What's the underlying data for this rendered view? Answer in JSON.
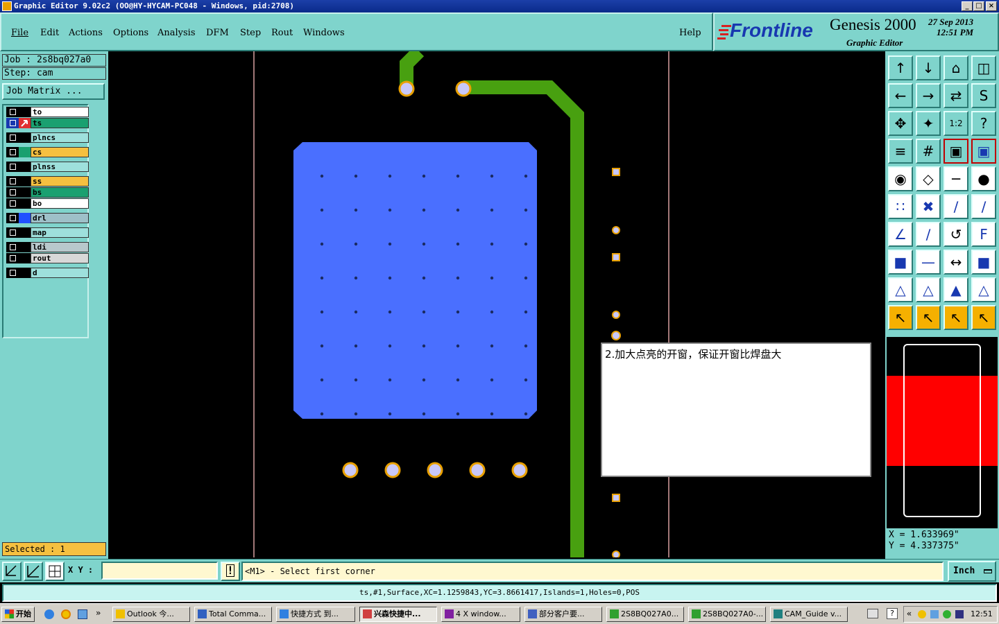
{
  "window": {
    "title": "Graphic Editor 9.02c2  (OO@HY-HYCAM-PC048 - Windows, pid:2708)",
    "min": "_",
    "max": "□",
    "close": "×"
  },
  "menu": {
    "items": [
      "File",
      "Edit",
      "Actions",
      "Options",
      "Analysis",
      "DFM",
      "Step",
      "Rout",
      "Windows"
    ],
    "help": "Help"
  },
  "brand": {
    "logo": "Frontline",
    "product": "Genesis 2000",
    "subtitle": "Graphic Editor",
    "date": "27 Sep 2013",
    "time": "12:51 PM"
  },
  "job": {
    "job_label": "Job : 2s8bq027a0",
    "step_label": "Step: cam",
    "matrix_button": "Job Matrix ..."
  },
  "layers": [
    {
      "name": "to",
      "color": "#ffffff",
      "swatch": "#000000"
    },
    {
      "name": "ts",
      "color": "#1aa070",
      "swatch": "#e03030",
      "active": true
    },
    {
      "name": "plncs",
      "color": "#9ee0dc",
      "swatch": "#000000"
    },
    {
      "name": "cs",
      "color": "#f5c040",
      "swatch": "#1aa070"
    },
    {
      "name": "plnss",
      "color": "#9ee0dc",
      "swatch": "#000000"
    },
    {
      "name": "ss",
      "color": "#f5c040",
      "swatch": "#000000"
    },
    {
      "name": "bs",
      "color": "#1aa070",
      "swatch": "#000000"
    },
    {
      "name": "bo",
      "color": "#ffffff",
      "swatch": "#000000"
    },
    {
      "name": "drl",
      "color": "#9ec0c8",
      "swatch": "#2050ff"
    },
    {
      "name": "map",
      "color": "#9ee0dc",
      "swatch": "#000000"
    },
    {
      "name": "ldi",
      "color": "#b8c8cc",
      "swatch": "#000000"
    },
    {
      "name": "rout",
      "color": "#d8d8d8",
      "swatch": "#000000"
    },
    {
      "name": "d",
      "color": "#9ee0dc",
      "swatch": "#000000"
    }
  ],
  "selected": "Selected : 1",
  "popup": {
    "text": "2.加大点亮的开窗，保证开窗比焊盘大"
  },
  "coords": {
    "x": "X =  1.633969\"",
    "y": "Y =  4.337375\""
  },
  "bottom": {
    "xy_label": "X Y :",
    "xy_value": "",
    "prompt": "<M1> - Select first corner",
    "units": "Inch"
  },
  "status": "ts,#1,Surface,XC=1.1259843,YC=3.8661417,Islands=1,Holes=0,POS",
  "taskbar": {
    "start": "开始",
    "tasks": [
      "Outlook 今...",
      "Total Comma...",
      "快捷方式 到...",
      "兴森快捷中...",
      "4 X window...",
      "部分客户要...",
      "2S8BQ027A0...",
      "2S8BQ027A0-...",
      "CAM_Guide v..."
    ],
    "clock": "12:51",
    "chevron": "»",
    "tray_chevron": "«"
  },
  "colors": {
    "teal": "#7fd4cc",
    "surface": "#4a6fff",
    "trace": "#48a010",
    "pad_ring": "#e8a000",
    "pad_center": "#c8c8f8"
  }
}
